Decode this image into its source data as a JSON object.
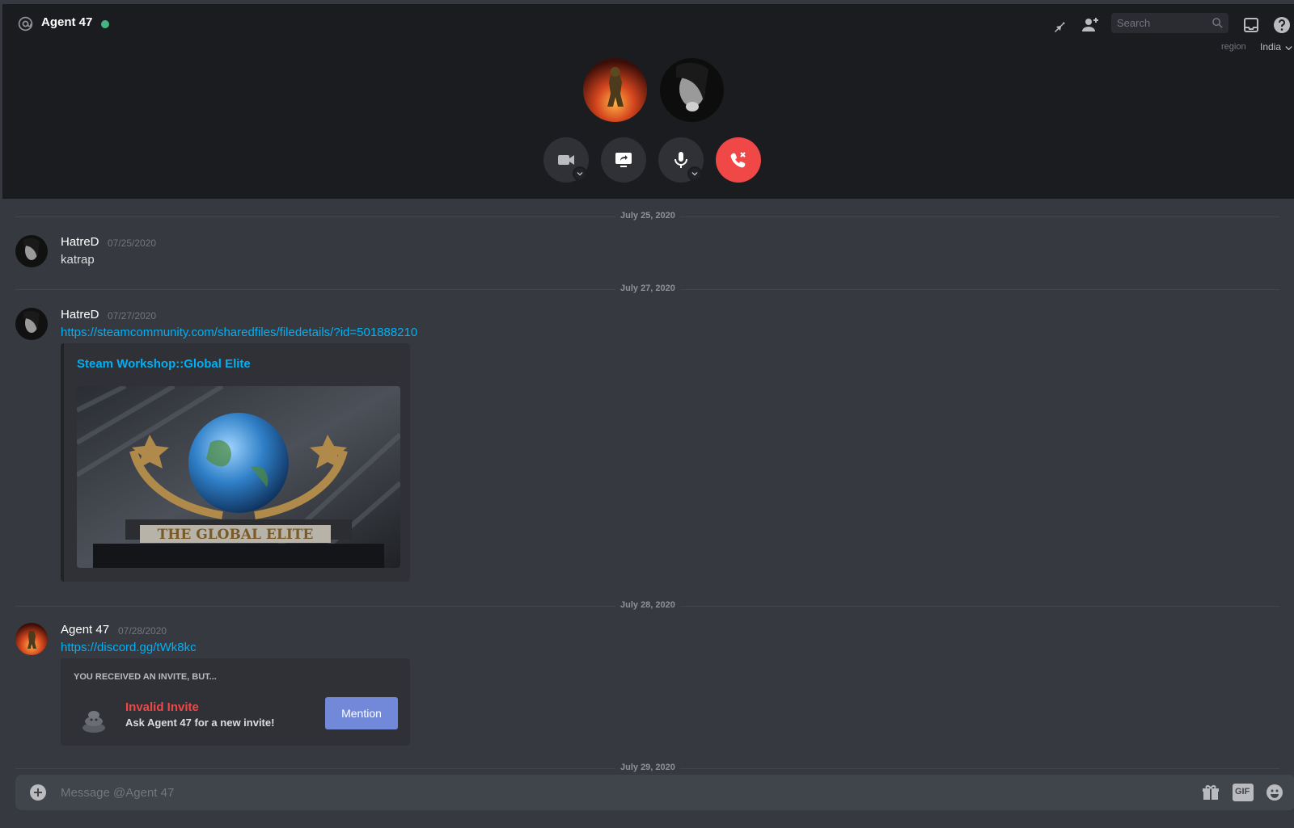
{
  "header": {
    "channel_name": "Agent 47",
    "search_placeholder": "Search",
    "region_label": "region",
    "region_value": "India"
  },
  "call": {
    "participants": [
      "Agent 47",
      "HatreD"
    ]
  },
  "messages": [
    {
      "date": "July 25, 2020",
      "author": "HatreD",
      "timestamp": "07/25/2020",
      "text": "katrap"
    },
    {
      "date": "July 27, 2020",
      "author": "HatreD",
      "timestamp": "07/27/2020",
      "link": "https://steamcommunity.com/sharedfiles/filedetails/?id=501888210",
      "embed": {
        "title": "Steam Workshop::Global Elite",
        "image_caption": "THE GLOBAL ELITE"
      }
    },
    {
      "date": "July 28, 2020",
      "author": "Agent 47",
      "timestamp": "07/28/2020",
      "link": "https://discord.gg/tWk8kc",
      "invite": {
        "heading": "YOU RECEIVED AN INVITE, BUT...",
        "title": "Invalid Invite",
        "subtitle": "Ask Agent 47 for a new invite!",
        "button": "Mention"
      }
    }
  ],
  "trailing_divider": "July 29, 2020",
  "composer": {
    "placeholder": "Message @Agent 47",
    "gif_label": "GIF"
  },
  "colors": {
    "online": "#43b581",
    "danger": "#f04747",
    "link": "#00b0f4",
    "blurple": "#7289da"
  }
}
